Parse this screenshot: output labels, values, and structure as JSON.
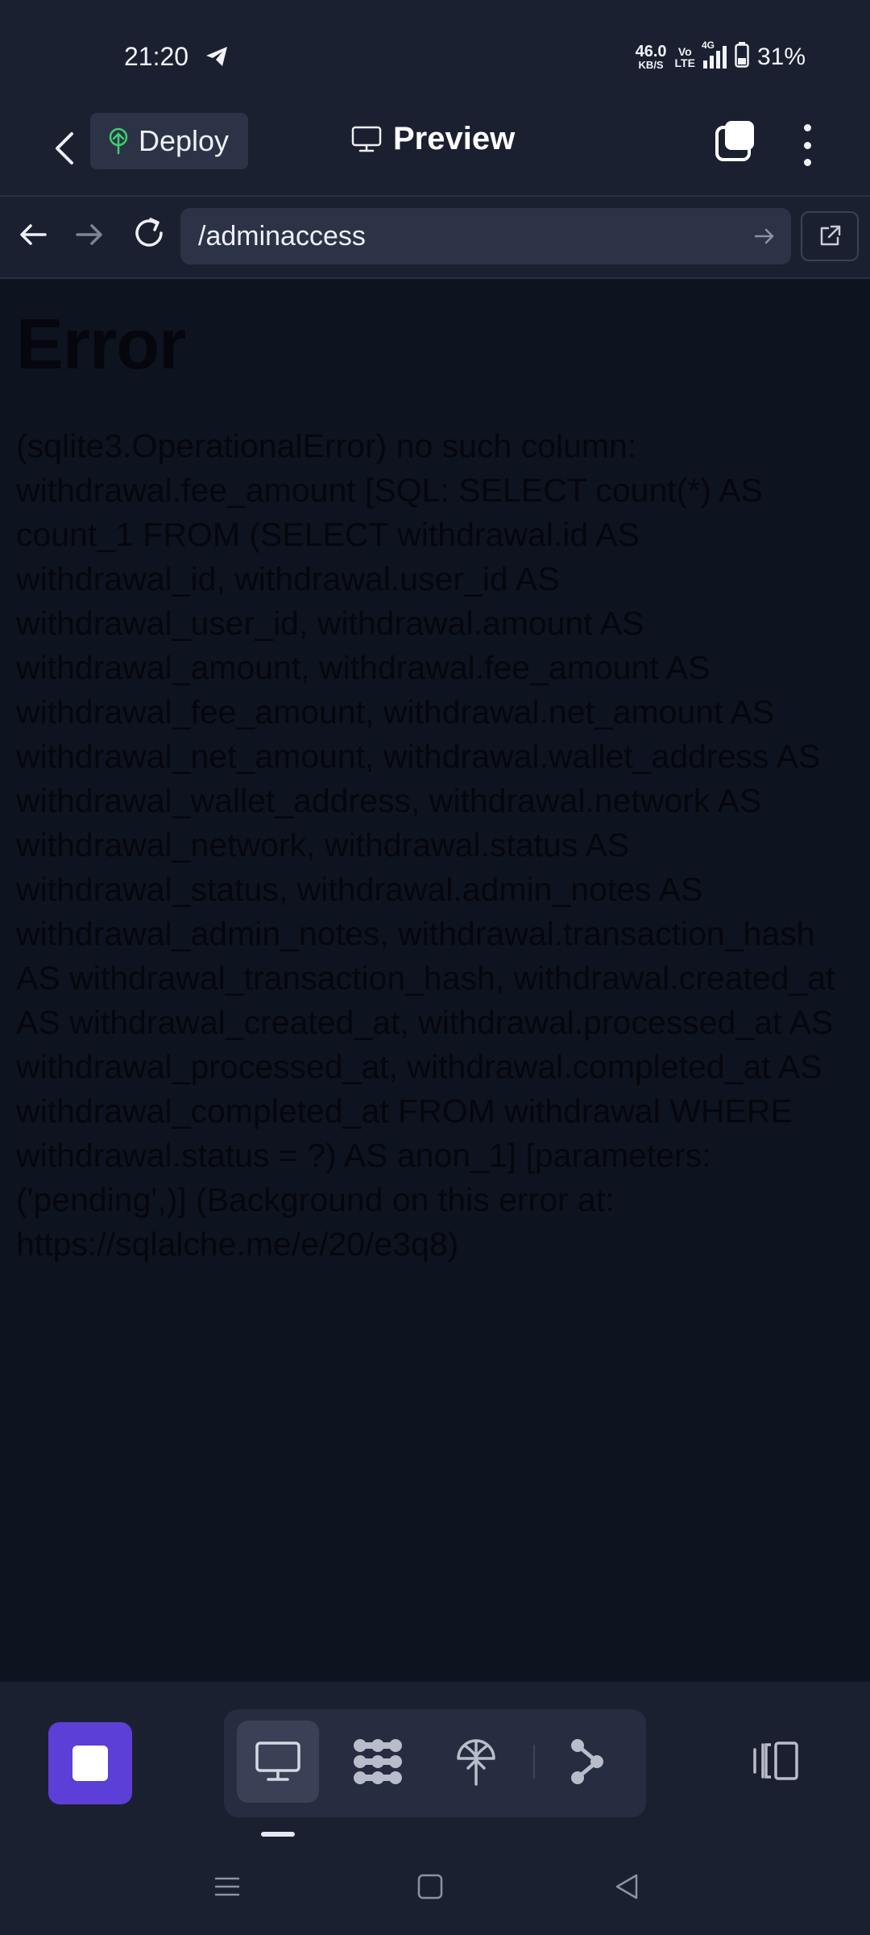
{
  "status_bar": {
    "time": "21:20",
    "net_speed_value": "46.0",
    "net_speed_unit": "KB/S",
    "volte_top": "Vo",
    "volte_bottom": "LTE",
    "network": "4G",
    "battery": "31%"
  },
  "top_bar": {
    "deploy_label": "Deploy",
    "title": "Preview"
  },
  "browser": {
    "url": "/adminaccess"
  },
  "page": {
    "heading": "Error",
    "message": "(sqlite3.OperationalError) no such column: withdrawal.fee_amount [SQL: SELECT count(*) AS count_1 FROM (SELECT withdrawal.id AS withdrawal_id, withdrawal.user_id AS withdrawal_user_id, withdrawal.amount AS withdrawal_amount, withdrawal.fee_amount AS withdrawal_fee_amount, withdrawal.net_amount AS withdrawal_net_amount, withdrawal.wallet_address AS withdrawal_wallet_address, withdrawal.network AS withdrawal_network, withdrawal.status AS withdrawal_status, withdrawal.admin_notes AS withdrawal_admin_notes, withdrawal.transaction_hash AS withdrawal_transaction_hash, withdrawal.created_at AS withdrawal_created_at, withdrawal.processed_at AS withdrawal_processed_at, withdrawal.completed_at AS withdrawal_completed_at FROM withdrawal WHERE withdrawal.status = ?) AS anon_1] [parameters: ('pending',)] (Background on this error at: https://sqlalche.me/e/20/e3q8)"
  },
  "bottom_toolbar": {
    "icons": [
      "stop-icon",
      "desktop-icon",
      "nodes-icon",
      "deploy-icon",
      "branch-icon",
      "panel-icon"
    ],
    "accent_color": "#5b3fd6"
  }
}
